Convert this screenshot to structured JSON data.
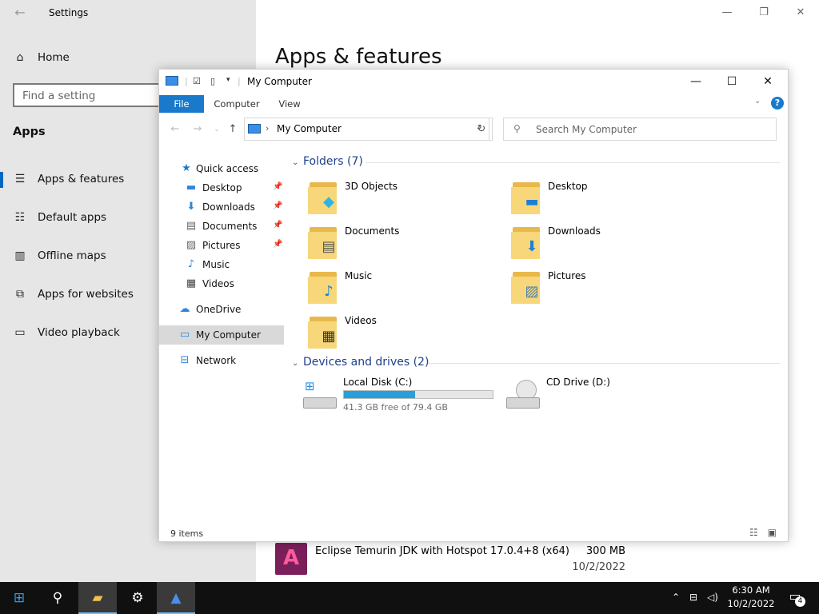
{
  "settings": {
    "title": "Settings",
    "home": "Home",
    "search_placeholder": "Find a setting",
    "section": "Apps",
    "nav": [
      {
        "label": "Apps & features",
        "icon": "list-icon"
      },
      {
        "label": "Default apps",
        "icon": "default-apps-icon"
      },
      {
        "label": "Offline maps",
        "icon": "map-icon"
      },
      {
        "label": "Apps for websites",
        "icon": "web-apps-icon"
      },
      {
        "label": "Video playback",
        "icon": "video-icon"
      }
    ],
    "page_title": "Apps & features",
    "app": {
      "name": "Eclipse Temurin JDK with Hotspot 17.0.4+8 (x64)",
      "size": "300 MB",
      "date": "10/2/2022"
    }
  },
  "explorer": {
    "title": "My Computer",
    "tabs": {
      "file": "File",
      "computer": "Computer",
      "view": "View"
    },
    "help": "?",
    "address": "My Computer",
    "search_placeholder": "Search My Computer",
    "nav": {
      "quick_access": "Quick access",
      "desktop": "Desktop",
      "downloads": "Downloads",
      "documents": "Documents",
      "pictures": "Pictures",
      "music": "Music",
      "videos": "Videos",
      "onedrive": "OneDrive",
      "my_computer": "My Computer",
      "network": "Network"
    },
    "folders_header": "Folders (7)",
    "folders": [
      "3D Objects",
      "Desktop",
      "Documents",
      "Downloads",
      "Music",
      "Pictures",
      "Videos"
    ],
    "drives_header": "Devices and drives (2)",
    "drives": [
      {
        "name": "Local Disk (C:)",
        "free": "41.3 GB free of 79.4 GB",
        "used_fraction": 0.48
      },
      {
        "name": "CD Drive (D:)"
      }
    ],
    "status": "9 items"
  },
  "taskbar": {
    "time": "6:30 AM",
    "date": "10/2/2022",
    "notifications": "4"
  },
  "colors": {
    "accent": "#0067c0",
    "file_tab": "#1979ca",
    "drive_bar": "#26a0da",
    "folder": "#f7d77a"
  }
}
